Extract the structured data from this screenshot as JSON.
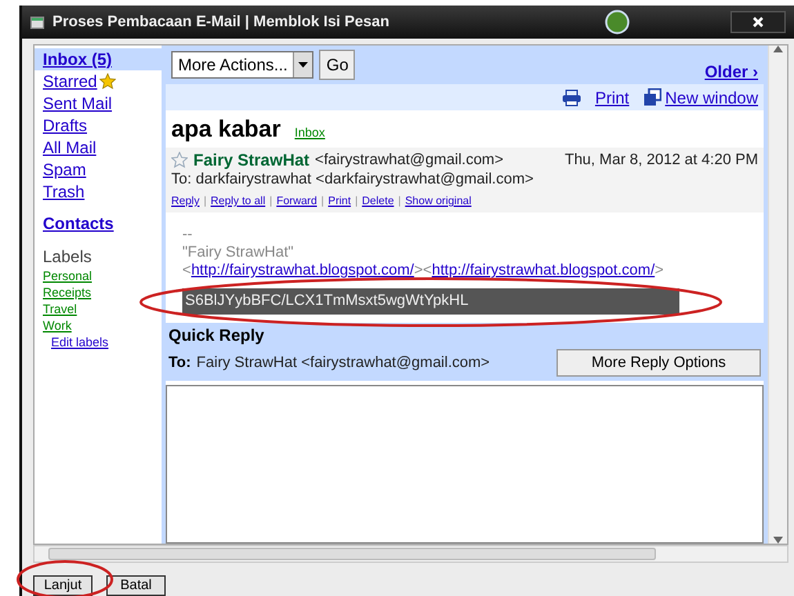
{
  "window": {
    "title": "Proses Pembacaan E-Mail | Memblok Isi Pesan"
  },
  "sidebar": {
    "items": [
      {
        "label": "Inbox (5)",
        "selected": true,
        "starred": false
      },
      {
        "label": "Starred",
        "selected": false,
        "starred": true
      },
      {
        "label": "Sent Mail",
        "selected": false,
        "starred": false
      },
      {
        "label": "Drafts",
        "selected": false,
        "starred": false
      },
      {
        "label": "All Mail",
        "selected": false,
        "starred": false
      },
      {
        "label": "Spam",
        "selected": false,
        "starred": false
      },
      {
        "label": "Trash",
        "selected": false,
        "starred": false
      }
    ],
    "contacts": "Contacts",
    "labels_heading": "Labels",
    "labels": [
      "Personal",
      "Receipts",
      "Travel",
      "Work"
    ],
    "edit_labels": "Edit labels"
  },
  "toolbar": {
    "actions_select": "More Actions...",
    "go": "Go",
    "older": "Older ›"
  },
  "links": {
    "print": "Print",
    "new_window": "New window"
  },
  "subject": "apa kabar",
  "subject_tag": "Inbox",
  "message": {
    "starred": false,
    "sender_name": "Fairy StrawHat",
    "sender_email": "<fairystrawhat@gmail.com>",
    "date": "Thu, Mar 8, 2012 at 4:20 PM",
    "to": "To: darkfairystrawhat <darkfairystrawhat@gmail.com>",
    "actions": [
      "Reply",
      "Reply to all",
      "Forward",
      "Print",
      "Delete",
      "Show original"
    ],
    "action_separator": "|",
    "signature_dash": "--",
    "signature_name": "\"Fairy StrawHat\"",
    "signature_line": [
      {
        "kind": "text",
        "text": "<"
      },
      {
        "kind": "link",
        "text": "http://fairystrawhat.blogspot.com/"
      },
      {
        "kind": "text",
        "text": "><"
      },
      {
        "kind": "link",
        "text": "http://fairystrawhat.blogspot.com/"
      },
      {
        "kind": "text",
        "text": ">"
      }
    ],
    "selected_text": "S6BlJYybBFC/LCX1TmMsxt5wgWtYpkHL"
  },
  "quick_reply": {
    "title": "Quick Reply",
    "to_label": "To:",
    "to_value": "Fairy StrawHat <fairystrawhat@gmail.com>",
    "more_options": "More Reply Options"
  },
  "buttons": [
    {
      "label": "Lanjut",
      "circled": true
    },
    {
      "label": "Batal",
      "circled": false
    }
  ]
}
